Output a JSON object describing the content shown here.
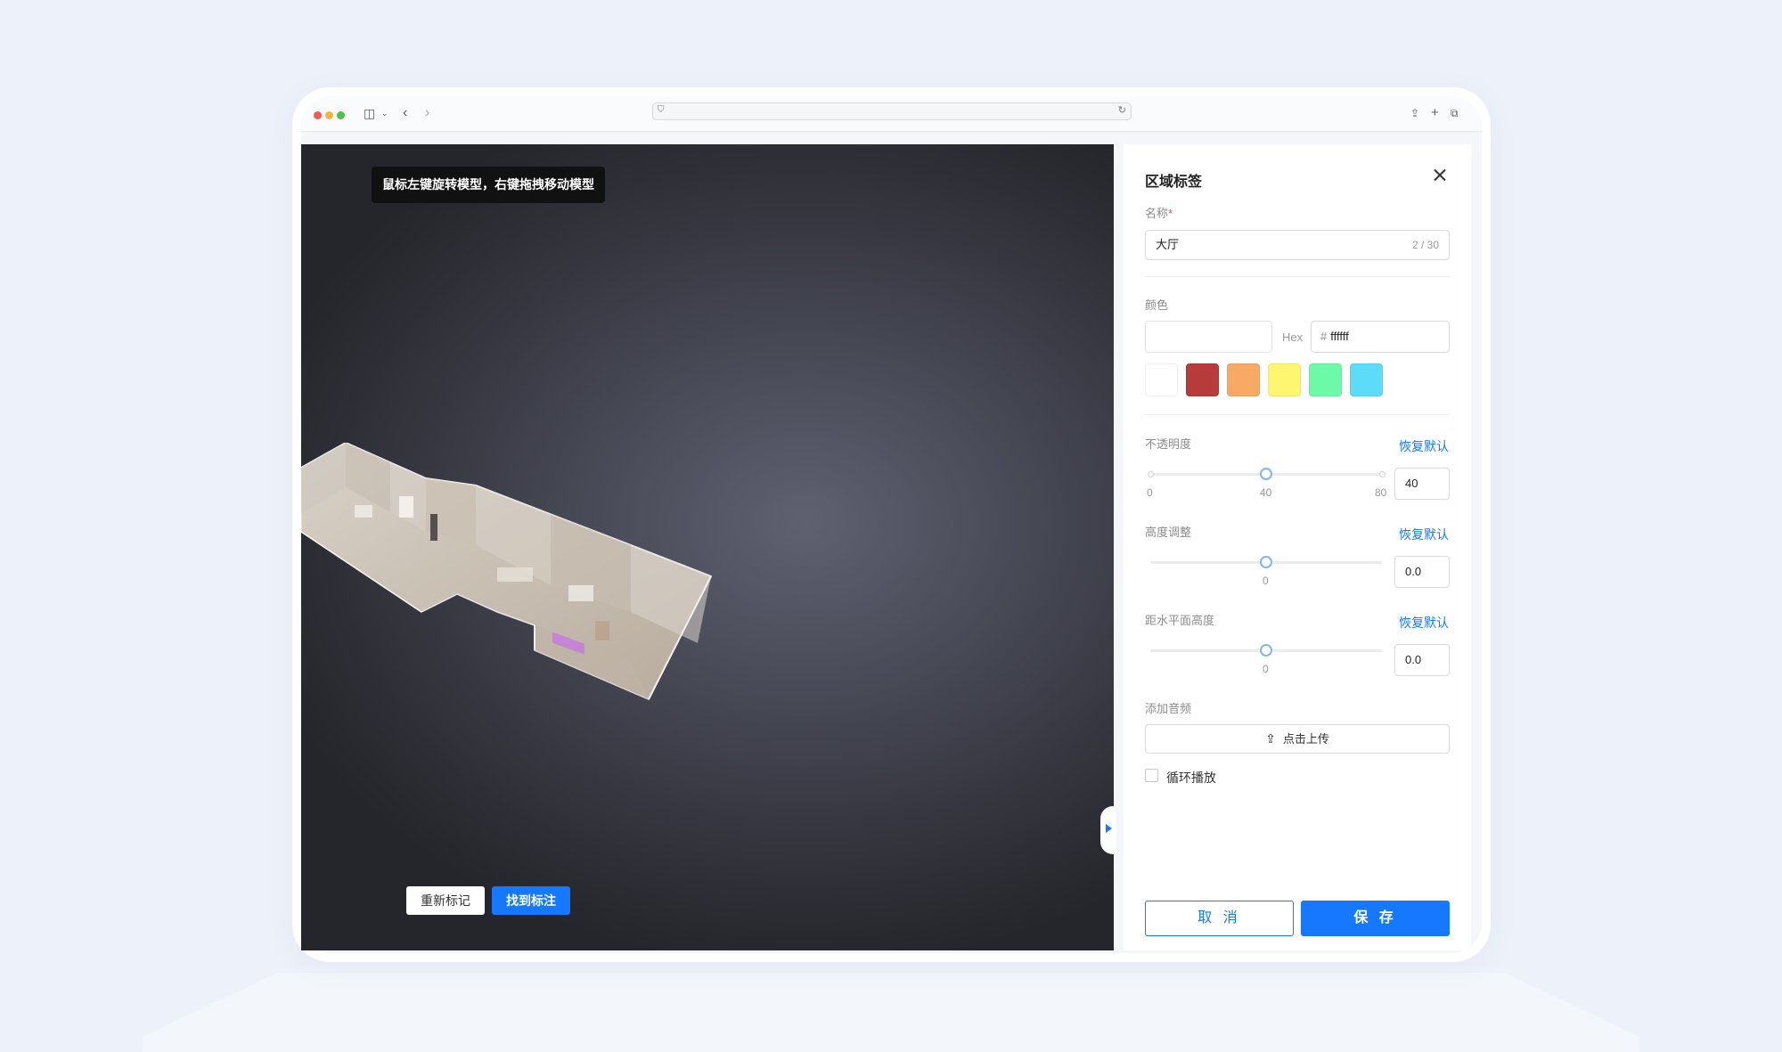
{
  "browser": {
    "address": ""
  },
  "viewport": {
    "hint": "鼠标左键旋转模型，右键拖拽移动模型",
    "remark_button": "重新标记",
    "find_button": "找到标注"
  },
  "panel": {
    "title": "区域标签",
    "name_label": "名称",
    "name_required": "*",
    "name_value": "大厅",
    "name_counter": "2 / 30",
    "color_label": "颜色",
    "hex_label": "Hex",
    "hex_prefix": "#",
    "hex_value": "ffffff",
    "swatches": [
      "#ffffff",
      "#b83b3b",
      "#f8a963",
      "#fdf66e",
      "#6dfaa8",
      "#5ddcf7"
    ],
    "opacity": {
      "label": "不透明度",
      "reset": "恢复默认",
      "min": "0",
      "mid": "40",
      "max": "80",
      "value": "40"
    },
    "height": {
      "label": "高度调整",
      "reset": "恢复默认",
      "tick": "0",
      "value": "0.0"
    },
    "elevation": {
      "label": "距水平面高度",
      "reset": "恢复默认",
      "tick": "0",
      "value": "0.0"
    },
    "audio_label": "添加音频",
    "upload_label": "点击上传",
    "loop_label": "循环播放",
    "cancel_button": "取 消",
    "save_button": "保 存"
  }
}
